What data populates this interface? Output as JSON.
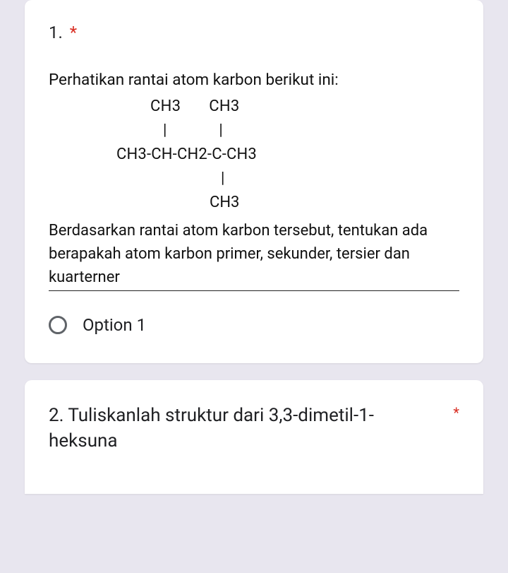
{
  "required_mark": "*",
  "q1": {
    "number": "1.",
    "instruction_line": "Perhatikan rantai atom karbon berikut ini:",
    "structure": {
      "row1_left": "CH3",
      "row1_right": "CH3",
      "row2_left": "|",
      "row2_right": "|",
      "row3": "CH3-CH-CH2-C-CH3",
      "row4": "|",
      "row5": "CH3"
    },
    "conclusion": "Berdasarkan rantai atom karbon tersebut, tentukan ada berapakah atom karbon primer, sekunder, tersier dan kuarterner",
    "option1_label": "Option 1"
  },
  "q2": {
    "title": "2. Tuliskanlah struktur dari 3,3-dimetil-1-heksuna"
  }
}
